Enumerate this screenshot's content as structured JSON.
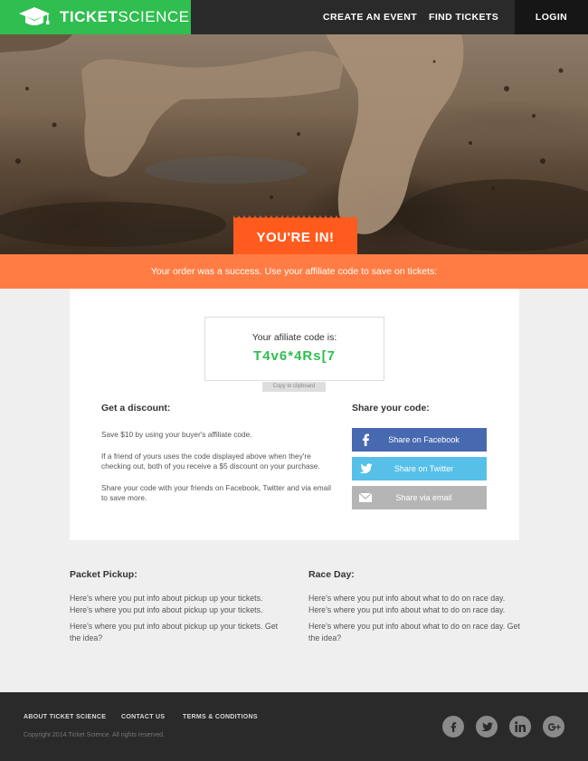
{
  "header": {
    "brand_bold": "TICKET",
    "brand_light": "SCIENCE",
    "nav": {
      "create": "CREATE AN EVENT",
      "find": "FIND TICKETS",
      "login": "LOGIN"
    }
  },
  "hero": {
    "badge": "YOU'RE IN!",
    "banner": "Your order was a success. Use your affiliate code to save on tickets:"
  },
  "affiliate": {
    "label": "Your afiliate code is:",
    "code": "T4v6*4Rs[7",
    "copy_label": "Copy to clipboard"
  },
  "discount": {
    "title": "Get a discount:",
    "paragraphs": [
      "Save $10 by using your buyer's affiliate code.",
      "If a friend of yours uses the code displayed above when they're checking out, both of you receive a $5 discount on your purchase.",
      "Share your code with your friends on Facebook, Twitter and via email to save more."
    ]
  },
  "share": {
    "title": "Share your code:",
    "facebook": "Share on Facebook",
    "twitter": "Share on Twitter",
    "email": "Share via email"
  },
  "packet_pickup": {
    "title": "Packet Pickup:",
    "paragraphs": [
      "Here's where you put info about pickup up your tickets. Here's where you put info about pickup up your tickets.",
      "Here's where you put info about pickup up your tickets. Get the idea?"
    ]
  },
  "race_day": {
    "title": "Race Day:",
    "paragraphs": [
      "Here's where you put info about what to do on race day. Here's where you put info about what to do on race day.",
      "Here's where you put info about what to do on race day. Get the idea?"
    ]
  },
  "footer": {
    "links": {
      "about": "ABOUT TICKET SCIENCE",
      "contact": "CONTACT US",
      "terms": "TERMS & CONDITIONS"
    },
    "copyright": "Copyright 2014 Ticket Science. All rights reserved.",
    "social": [
      "facebook-icon",
      "twitter-icon",
      "linkedin-icon",
      "google-plus-icon"
    ]
  },
  "colors": {
    "brand_green": "#2fbe4f",
    "accent_orange": "#ff5b1e",
    "banner_orange": "#ff7d45",
    "facebook": "#4769b0",
    "twitter": "#56c0e8",
    "email": "#b5b5b5"
  }
}
